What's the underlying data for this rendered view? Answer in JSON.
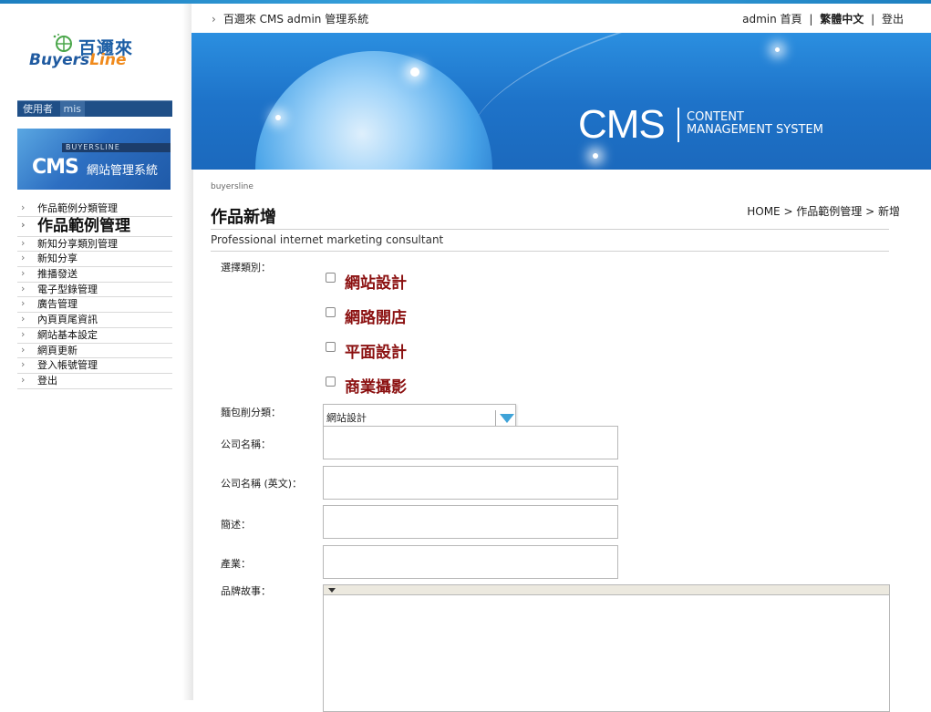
{
  "app": {
    "logo_cn": "百邇來",
    "logo_en_a": "Buyers",
    "logo_en_b": "Line"
  },
  "user": {
    "label": "使用者",
    "name": "mis"
  },
  "cms_banner": {
    "strip": "BUYERSLINE",
    "big": "CMS",
    "small": "網站管理系統"
  },
  "menu": {
    "items": [
      {
        "label": "作品範例分類管理"
      },
      {
        "label": "作品範例管理"
      },
      {
        "label": "新知分享類別管理"
      },
      {
        "label": "新知分享"
      },
      {
        "label": "推播發送"
      },
      {
        "label": "電子型錄管理"
      },
      {
        "label": "廣告管理"
      },
      {
        "label": "內頁頁尾資訊"
      },
      {
        "label": "網站基本設定"
      },
      {
        "label": "網頁更新"
      },
      {
        "label": "登入帳號管理"
      },
      {
        "label": "登出"
      }
    ]
  },
  "header": {
    "crumb": "百邇來 CMS admin 管理系統",
    "admin": "admin",
    "home": "首頁",
    "lang": "繁體中文",
    "logout": "登出"
  },
  "banner": {
    "cms": "CMS",
    "line1": "CONTENT",
    "line2": "MANAGEMENT SYSTEM"
  },
  "page": {
    "brand": "buyersline",
    "title": "作品新增",
    "crumb": "HOME > 作品範例管理 > 新增",
    "subtitle": "Professional internet marketing consultant"
  },
  "form": {
    "category_label": "選擇類別：",
    "categories": [
      {
        "label": "網站設計",
        "checked": false
      },
      {
        "label": "網路開店",
        "checked": false
      },
      {
        "label": "平面設計",
        "checked": false
      },
      {
        "label": "商業攝影",
        "checked": false
      }
    ],
    "breadcrumb_label": "麵包削分類：",
    "breadcrumb_value": "網站設計",
    "company_label": "公司名稱：",
    "company_value": "",
    "company_en_label": "公司名稱 (英文)：",
    "company_en_value": "",
    "summary_label": "簡述：",
    "summary_value": "",
    "industry_label": "產業：",
    "industry_value": "",
    "story_label": "品牌故事："
  }
}
